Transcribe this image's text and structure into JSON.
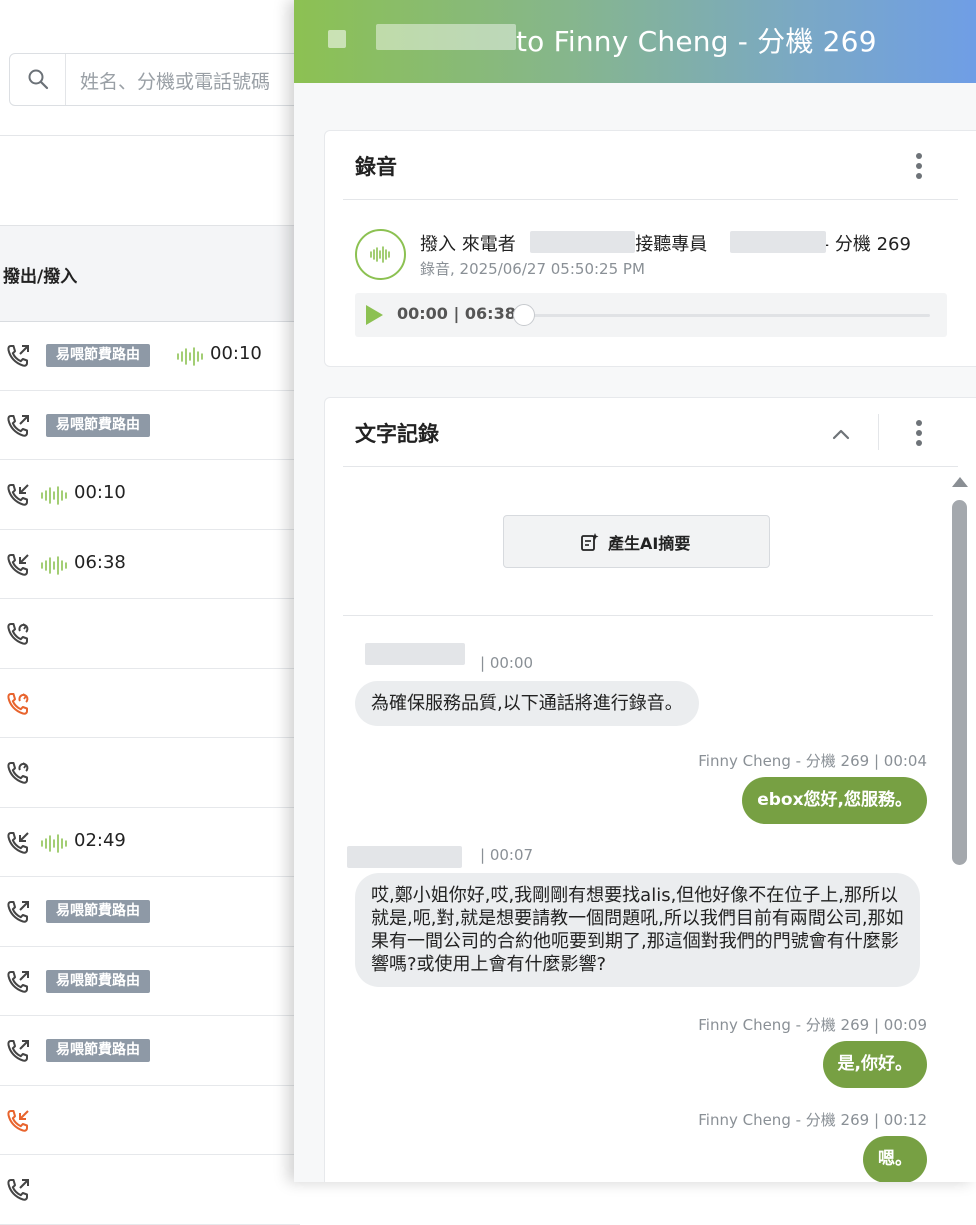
{
  "list": {
    "search_placeholder": "姓名、分機或電話號碼",
    "column_header": "撥出/撥入",
    "rows": [
      {
        "dir": "out",
        "color": "#444",
        "badge": "易喂節費路由",
        "duration": "00:10"
      },
      {
        "dir": "out",
        "color": "#444",
        "badge": "易喂節費路由",
        "duration": ""
      },
      {
        "dir": "in",
        "color": "#444",
        "badge": "",
        "duration": "00:10"
      },
      {
        "dir": "in",
        "color": "#444",
        "badge": "",
        "duration": "06:38"
      },
      {
        "dir": "transfer",
        "color": "#444",
        "badge": "",
        "duration": ""
      },
      {
        "dir": "transfer",
        "color": "#e8642e",
        "badge": "",
        "duration": ""
      },
      {
        "dir": "transfer",
        "color": "#444",
        "badge": "",
        "duration": ""
      },
      {
        "dir": "in",
        "color": "#444",
        "badge": "",
        "duration": "02:49"
      },
      {
        "dir": "out",
        "color": "#444",
        "badge": "易喂節費路由",
        "duration": ""
      },
      {
        "dir": "out",
        "color": "#444",
        "badge": "易喂節費路由",
        "duration": ""
      },
      {
        "dir": "out",
        "color": "#444",
        "badge": "易喂節費路由",
        "duration": ""
      },
      {
        "dir": "in",
        "color": "#e8642e",
        "badge": "",
        "duration": ""
      },
      {
        "dir": "out",
        "color": "#444",
        "badge": "",
        "duration": ""
      }
    ]
  },
  "drawer": {
    "title": "to Finny Cheng - 分機 269",
    "recording_card": {
      "title": "錄音",
      "call_title_prefix": "撥入 來電者",
      "call_title_mid": "接聽專員",
      "call_title_suffix": "- 分機 269",
      "subtitle": "錄音, 2025/06/27 05:50:25 PM",
      "time_readout": "00:00 | 06:38",
      "progress": 0
    },
    "transcript_card": {
      "title": "文字記錄",
      "ai_button": "產生AI摘要",
      "messages": [
        {
          "side": "left",
          "meta": "| 00:00",
          "text": "為確保服務品質,以下通話將進行錄音。"
        },
        {
          "side": "right",
          "meta": "Finny Cheng - 分機 269 | 00:04",
          "text": "ebox您好,您服務。"
        },
        {
          "side": "left",
          "meta": "| 00:07",
          "text": "哎,鄭小姐你好,哎,我剛剛有想要找alis,但他好像不在位子上,那所以就是,呃,對,就是想要請教一個問題吼,所以我們目前有兩間公司,那如果有一間公司的合約他呃要到期了,那這個對我們的門號會有什麼影響嗎?或使用上會有什麼影響?"
        },
        {
          "side": "right",
          "meta": "Finny Cheng - 分機 269 | 00:09",
          "text": "是,你好。"
        },
        {
          "side": "right",
          "meta": "Finny Cheng - 分機 269 | 00:12",
          "text": "嗯。"
        }
      ]
    }
  },
  "colors": {
    "brand_green": "#8cc152",
    "bubble_green": "#77a043",
    "missed_orange": "#e8642e"
  }
}
